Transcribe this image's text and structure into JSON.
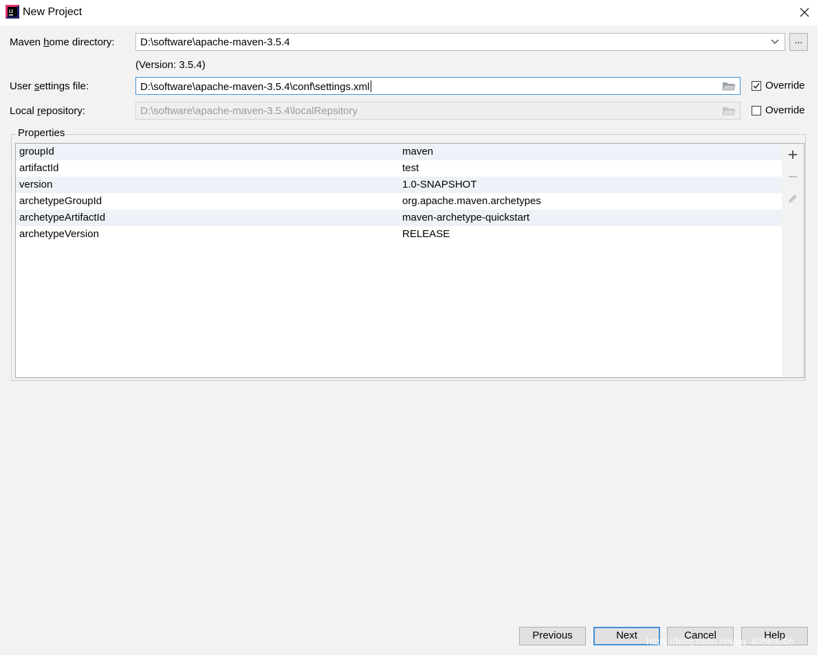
{
  "window": {
    "title": "New Project",
    "app_icon": "intellij-idea-icon",
    "close_icon": "close-icon"
  },
  "maven_home": {
    "label_pre": "Maven ",
    "label_mnemonic": "h",
    "label_post": "ome directory:",
    "value": "D:\\software\\apache-maven-3.5.4",
    "version_text": "(Version: 3.5.4)",
    "browse_label": "..."
  },
  "user_settings": {
    "label_pre": "User ",
    "label_mnemonic": "s",
    "label_post": "ettings file:",
    "value": "D:\\software\\apache-maven-3.5.4\\conf\\settings.xml",
    "override_label": "Override",
    "override_checked": true
  },
  "local_repo": {
    "label_pre": "Local ",
    "label_mnemonic": "r",
    "label_post": "epository:",
    "value": "D:\\software\\apache-maven-3.5.4\\localRepsitory",
    "override_label": "Override",
    "override_checked": false
  },
  "properties": {
    "legend": "Properties",
    "rows": [
      {
        "key": "groupId",
        "value": "maven"
      },
      {
        "key": "artifactId",
        "value": "test"
      },
      {
        "key": "version",
        "value": "1.0-SNAPSHOT"
      },
      {
        "key": "archetypeGroupId",
        "value": "org.apache.maven.archetypes"
      },
      {
        "key": "archetypeArtifactId",
        "value": "maven-archetype-quickstart"
      },
      {
        "key": "archetypeVersion",
        "value": "RELEASE"
      }
    ]
  },
  "buttons": {
    "previous": "Previous",
    "next": "Next",
    "cancel": "Cancel",
    "help": "Help"
  },
  "watermark": "https://blog.csdn.net/qq_40563505",
  "colors": {
    "focus_border": "#3d8fd6",
    "dialog_bg": "#f2f2f2",
    "row_alt": "#eef2f8"
  }
}
